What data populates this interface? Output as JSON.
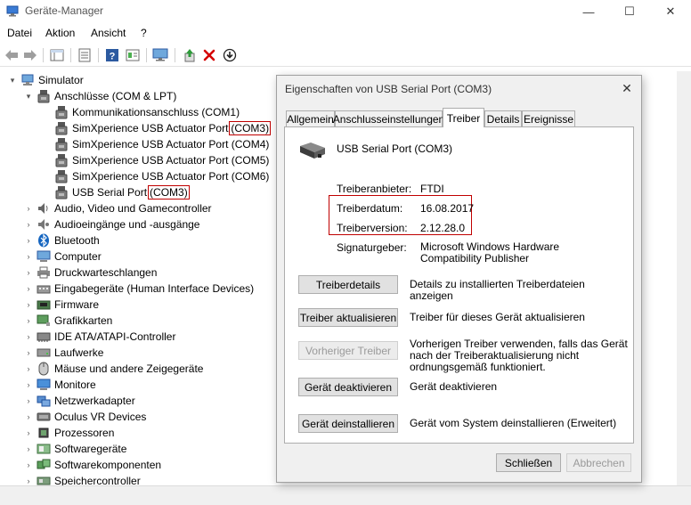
{
  "window": {
    "title": "Geräte-Manager",
    "controls": {
      "minimize": "—",
      "maximize": "☐",
      "close": "✕"
    }
  },
  "menubar": [
    "Datei",
    "Aktion",
    "Ansicht",
    "?"
  ],
  "toolbar": {
    "buttons": [
      "back-icon",
      "forward-icon",
      "tree-view-icon",
      "properties-icon",
      "help-icon",
      "details-icon",
      "monitor-scan-icon",
      "update-driver-icon",
      "uninstall-icon",
      "download-icon"
    ]
  },
  "tree": {
    "root": "Simulator",
    "ports": {
      "label": "Anschlüsse (COM & LPT)",
      "children": [
        {
          "name": "Kommunikationsanschluss (COM1)",
          "com": ""
        },
        {
          "name": "SimXperience USB Actuator Port",
          "com": "(COM3)"
        },
        {
          "name": "SimXperience USB Actuator Port (COM4)",
          "com": ""
        },
        {
          "name": "SimXperience USB Actuator Port (COM5)",
          "com": ""
        },
        {
          "name": "SimXperience USB Actuator Port (COM6)",
          "com": ""
        },
        {
          "name": "USB Serial Port",
          "com": "(COM3)"
        }
      ]
    },
    "categories": [
      "Audio, Video und Gamecontroller",
      "Audioeingänge und -ausgänge",
      "Bluetooth",
      "Computer",
      "Druckwarteschlangen",
      "Eingabegeräte (Human Interface Devices)",
      "Firmware",
      "Grafikkarten",
      "IDE ATA/ATAPI-Controller",
      "Laufwerke",
      "Mäuse und andere Zeigegeräte",
      "Monitore",
      "Netzwerkadapter",
      "Oculus VR Devices",
      "Prozessoren",
      "Softwaregeräte",
      "Softwarekomponenten",
      "Speichercontroller"
    ]
  },
  "dialog": {
    "title": "Eigenschaften von USB Serial Port (COM3)",
    "close": "✕",
    "tabs": [
      "Allgemein",
      "Anschlusseinstellungen",
      "Treiber",
      "Details",
      "Ereignisse"
    ],
    "active_tab": "Treiber",
    "device_name": "USB Serial Port (COM3)",
    "fields": {
      "provider_label": "Treiberanbieter:",
      "provider_value": "FTDI",
      "date_label": "Treiberdatum:",
      "date_value": "16.08.2017",
      "version_label": "Treiberversion:",
      "version_value": "2.12.28.0",
      "signer_label": "Signaturgeber:",
      "signer_value": "Microsoft Windows Hardware Compatibility Publisher"
    },
    "actions": [
      {
        "label": "Treiberdetails",
        "desc": "Details zu installierten Treiberdateien anzeigen",
        "enabled": true
      },
      {
        "label": "Treiber aktualisieren",
        "desc": "Treiber für dieses Gerät aktualisieren",
        "enabled": true
      },
      {
        "label": "Vorheriger Treiber",
        "desc": "Vorherigen Treiber verwenden, falls das Gerät nach der Treiberaktualisierung nicht ordnungsgemäß funktioniert.",
        "enabled": false
      },
      {
        "label": "Gerät deaktivieren",
        "desc": "Gerät deaktivieren",
        "enabled": true
      },
      {
        "label": "Gerät deinstallieren",
        "desc": "Gerät vom System deinstallieren (Erweitert)",
        "enabled": true
      }
    ],
    "footer": {
      "close_label": "Schließen",
      "cancel_label": "Abbrechen"
    }
  },
  "colors": {
    "highlight": "#c00000",
    "dialog_bg": "#f0f0f0",
    "button_bg": "#e1e1e1"
  }
}
